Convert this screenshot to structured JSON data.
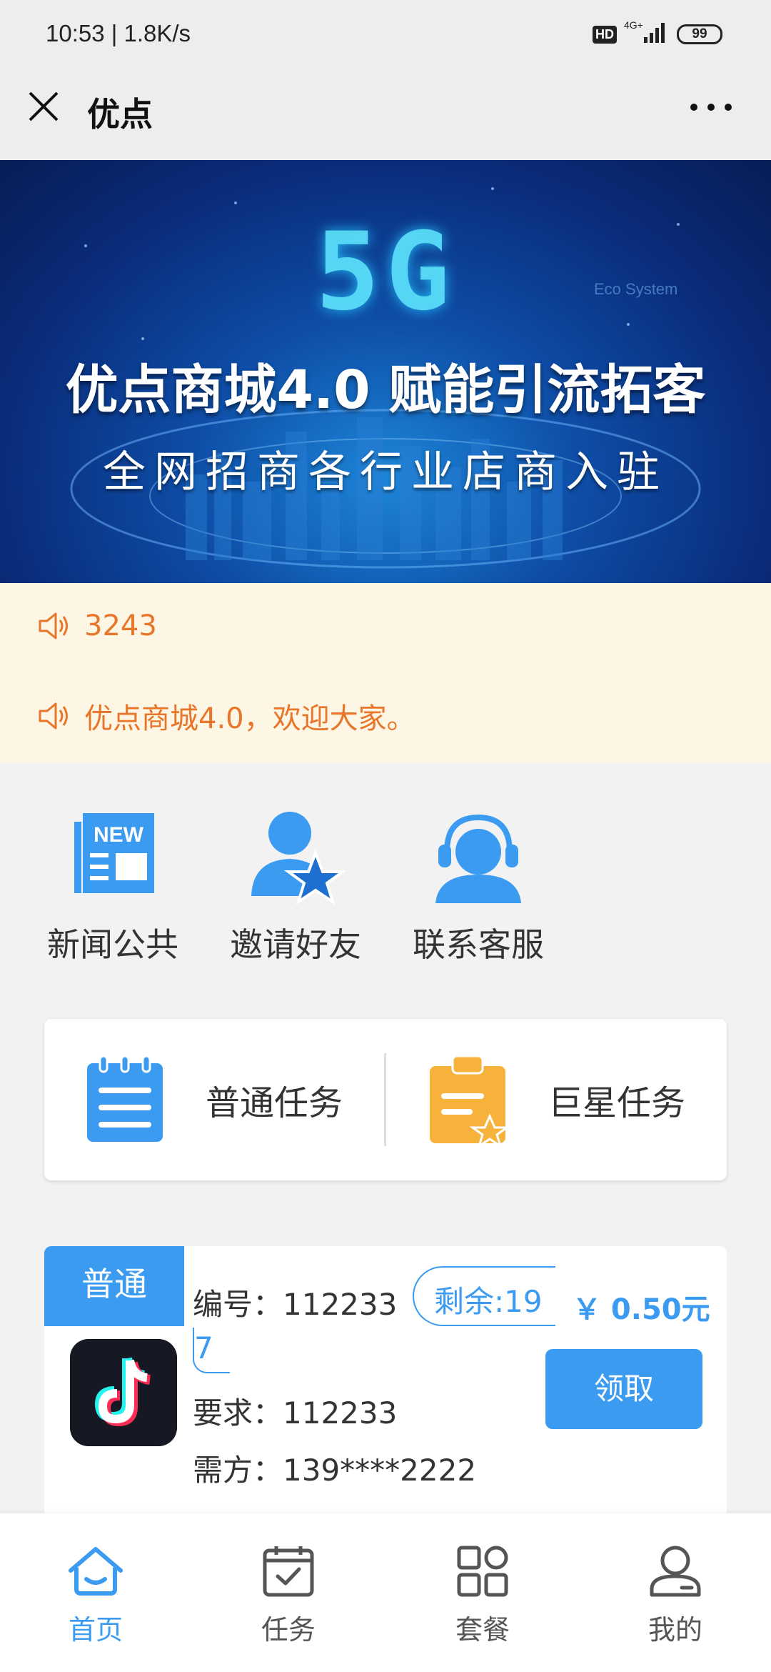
{
  "status_bar": {
    "time": "10:53 | 1.8K/s",
    "hd": "HD",
    "network": "4G+",
    "battery": "99"
  },
  "header": {
    "title": "优点",
    "close_icon": "close-icon",
    "more_icon": "more-icon"
  },
  "banner": {
    "big_text": "5G",
    "eco_text": "Eco System",
    "headline": "优点商城4.0 赋能引流拓客",
    "subline": "全网招商各行业店商入驻"
  },
  "notices": [
    {
      "icon": "speaker-icon",
      "text": "3243"
    },
    {
      "icon": "speaker-icon",
      "text": "优点商城4.0，欢迎大家。"
    }
  ],
  "quick_menu": [
    {
      "icon": "news-icon",
      "label": "新闻公共"
    },
    {
      "icon": "invite-friend-icon",
      "label": "邀请好友"
    },
    {
      "icon": "customer-service-icon",
      "label": "联系客服"
    }
  ],
  "task_types": [
    {
      "icon": "clipboard-icon",
      "label": "普通任务"
    },
    {
      "icon": "star-clipboard-icon",
      "label": "巨星任务"
    }
  ],
  "order": {
    "tag": "普通",
    "number": "编号：112233",
    "remaining_part1": "剩余:19",
    "remaining_part2": "7",
    "requirement": "要求：112233",
    "demander": "需方：139****2222",
    "price": "￥ 0.50元",
    "button": "领取"
  },
  "bottom_nav": [
    {
      "icon": "home-icon",
      "label": "首页",
      "active": true
    },
    {
      "icon": "task-icon",
      "label": "任务",
      "active": false
    },
    {
      "icon": "package-icon",
      "label": "套餐",
      "active": false
    },
    {
      "icon": "profile-icon",
      "label": "我的",
      "active": false
    }
  ],
  "colors": {
    "accent": "#3a9bf0",
    "notice_text": "#e8762a",
    "notice_bg": "#fdf6e4",
    "star_orange": "#f7b23b"
  }
}
